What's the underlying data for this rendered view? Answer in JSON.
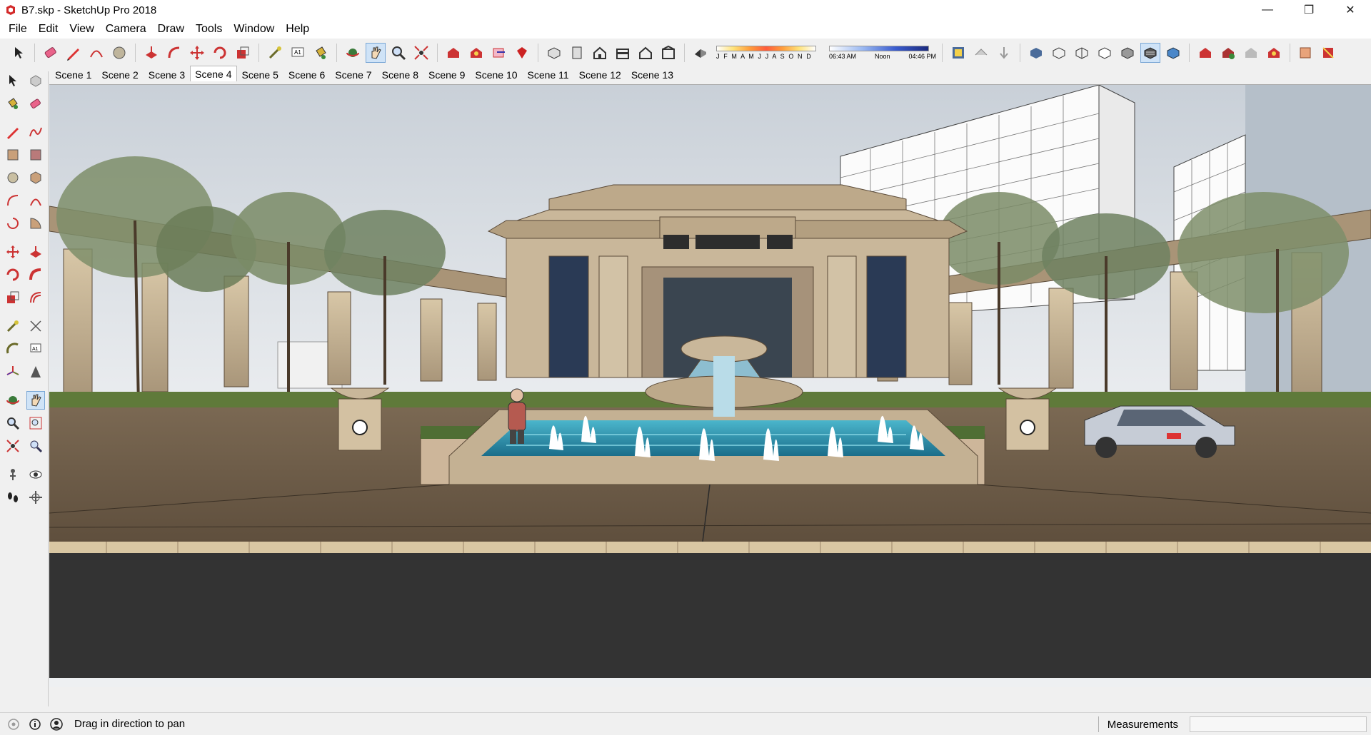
{
  "window": {
    "title": "B7.skp - SketchUp Pro 2018",
    "minimize": "—",
    "restore": "❐",
    "close": "✕"
  },
  "menu": [
    "File",
    "Edit",
    "View",
    "Camera",
    "Draw",
    "Tools",
    "Window",
    "Help"
  ],
  "shadow": {
    "months": "J F M A M J J A S O N D",
    "time_start": "06:43 AM",
    "time_mid": "Noon",
    "time_end": "04:46 PM"
  },
  "scenes": {
    "tabs": [
      "Scene 1",
      "Scene 2",
      "Scene 3",
      "Scene 4",
      "Scene 5",
      "Scene 6",
      "Scene 7",
      "Scene 8",
      "Scene 9",
      "Scene 10",
      "Scene 11",
      "Scene 12",
      "Scene 13"
    ],
    "active": "Scene 4"
  },
  "status": {
    "hint": "Drag in direction to pan",
    "measurements_label": "Measurements",
    "measurements_value": ""
  },
  "colors": {
    "sky": "#d5dbe2",
    "road": "#333333",
    "plaza": "#6b5a46",
    "water": "#2b95b3",
    "building": "#c9b79a"
  }
}
